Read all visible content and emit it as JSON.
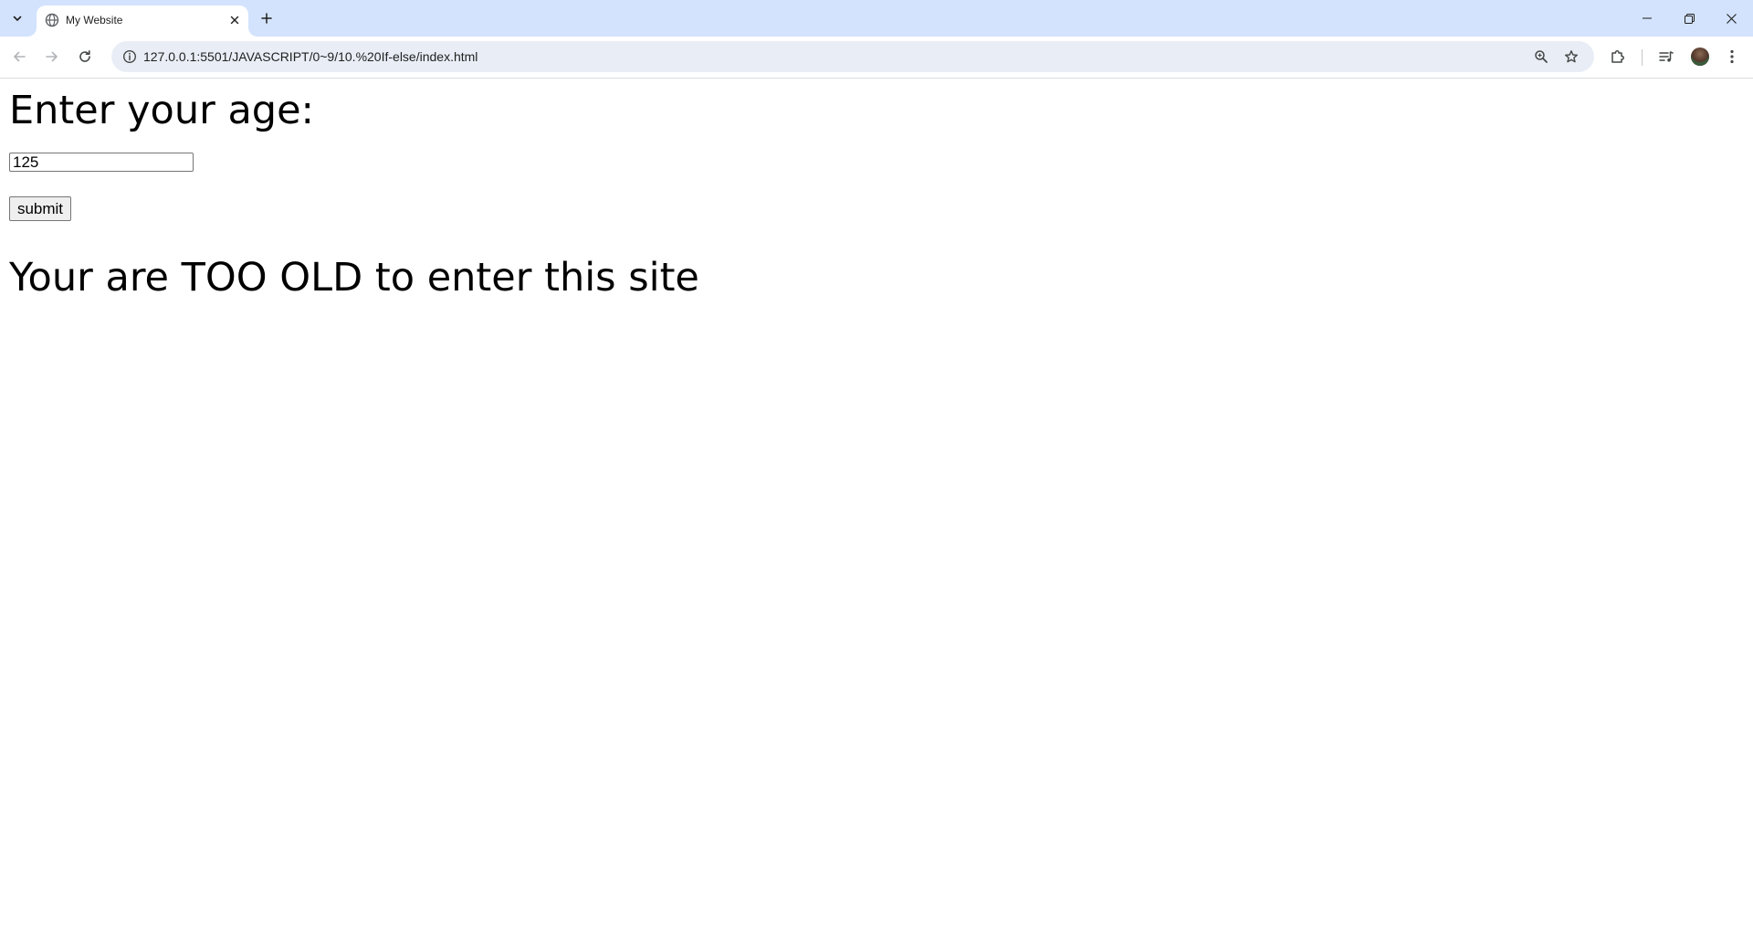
{
  "browser": {
    "tab": {
      "title": "My Website",
      "favicon": "globe-icon"
    },
    "address_bar": {
      "url": "127.0.0.1:5501/JAVASCRIPT/0~9/10.%20If-else/index.html"
    },
    "toolbar_icons": [
      "back-icon",
      "forward-icon",
      "reload-icon",
      "site-info-icon",
      "zoom-icon",
      "bookmark-star-icon",
      "extensions-icon",
      "media-controls-icon",
      "avatar",
      "menu-icon"
    ],
    "window_controls": [
      "minimize-icon",
      "restore-icon",
      "close-icon"
    ],
    "colors": {
      "tab_strip": "#d3e3fd",
      "omnibox": "#e9eef6"
    }
  },
  "page": {
    "heading": "Enter your age:",
    "age_input": {
      "value": "125"
    },
    "submit_label": "submit",
    "result_text": "Your are TOO OLD to enter this site"
  }
}
